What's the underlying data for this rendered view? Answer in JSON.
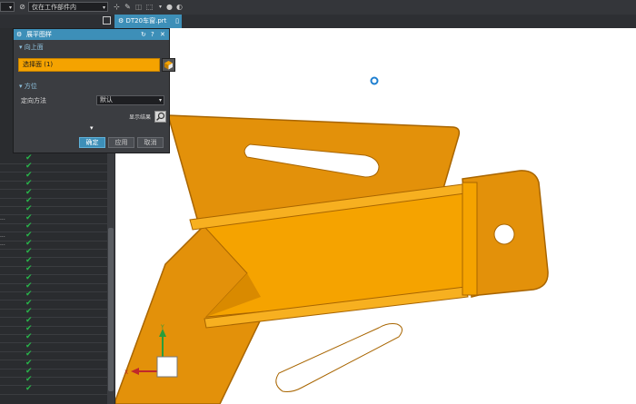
{
  "toolbar": {
    "combo1_value": "",
    "combo2_value": "仅在工作部件内"
  },
  "tabs": {
    "document": "DT20车窗.prt"
  },
  "dialog": {
    "title": "展平图样",
    "section_face": "向上面",
    "select_face": "选择面 (1)",
    "section_orientation": "方位",
    "orientation_label": "定向方法",
    "orientation_value": "默认",
    "show_result": "显示结果",
    "ok": "确定",
    "apply": "应用",
    "cancel": "取消"
  },
  "tree": {
    "row_labels": [
      "...",
      "...",
      "..."
    ]
  },
  "colors": {
    "accent": "#3d8fb8",
    "part_orange": "#f5a300",
    "part_edge": "#b97400",
    "check_green": "#28b44a"
  },
  "icons": [
    "gear-icon",
    "reset-icon",
    "help-icon",
    "close-icon",
    "cube-icon",
    "magnifier-icon",
    "checkmark-icon"
  ]
}
